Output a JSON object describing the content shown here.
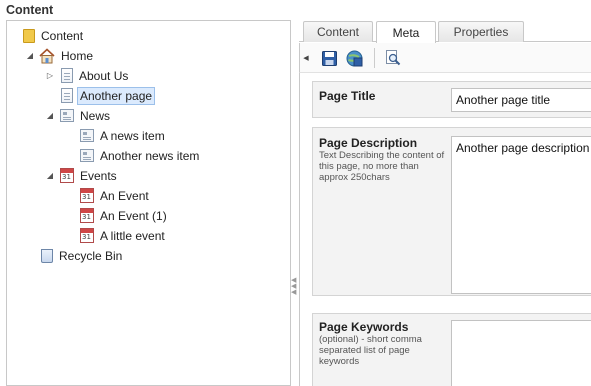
{
  "app": {
    "section_title": "Content"
  },
  "tree": {
    "root": "Content",
    "home": "Home",
    "about": "About Us",
    "another": "Another page",
    "news": "News",
    "news1": "A news item",
    "news2": "Another news item",
    "events": "Events",
    "event1": "An Event",
    "event2": "An Event (1)",
    "event3": "A little event",
    "bin": "Recycle Bin",
    "cal_day": "31"
  },
  "tabs": {
    "content": "Content",
    "meta": "Meta",
    "properties": "Properties",
    "active": "Meta"
  },
  "toolbar": {
    "icons": [
      "save-icon",
      "save-publish-icon",
      "preview-icon"
    ]
  },
  "fields": {
    "title": {
      "label": "Page Title",
      "value": "Another page title"
    },
    "description": {
      "label": "Page Description",
      "help": "Text Describing the content of this page, no more than approx 250chars",
      "value": "Another page description"
    },
    "keywords": {
      "label": "Page Keywords",
      "help": "(optional) - short comma separated list of page keywords",
      "value": ""
    }
  },
  "colors": {
    "selection_bg": "#dbeafd",
    "selection_border": "#9cc0ea",
    "folder": "#f1c94a",
    "calendar": "#d04747"
  }
}
